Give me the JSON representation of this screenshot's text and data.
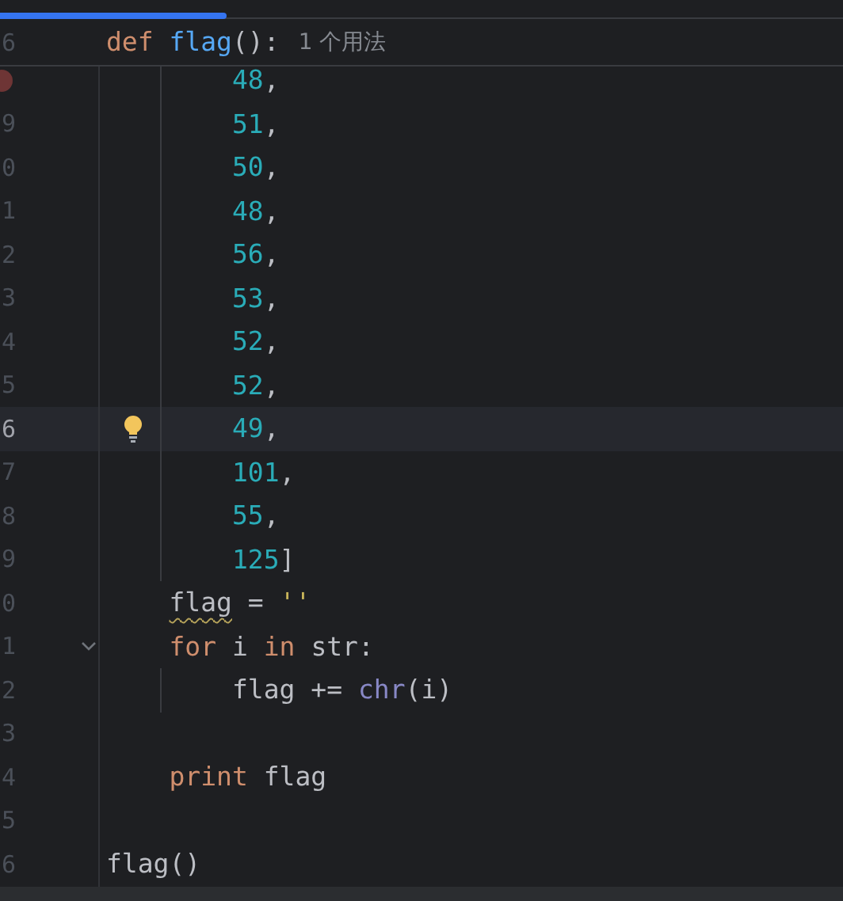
{
  "sticky_header": {
    "line_number": "6",
    "tokens": [
      {
        "kind": "keyword",
        "text": "def "
      },
      {
        "kind": "function",
        "text": "flag"
      },
      {
        "kind": "plain",
        "text": "():"
      }
    ],
    "usage_hint": "1 个用法"
  },
  "lines": [
    {
      "breakpoint": true,
      "current": false,
      "bulb": false,
      "foldable": false,
      "indent_guide": true,
      "tokens": [
        {
          "kind": "number",
          "text": "        48"
        },
        {
          "kind": "plain",
          "text": ","
        }
      ]
    },
    {
      "number": "9",
      "breakpoint": false,
      "current": false,
      "bulb": false,
      "foldable": false,
      "indent_guide": true,
      "tokens": [
        {
          "kind": "number",
          "text": "        51"
        },
        {
          "kind": "plain",
          "text": ","
        }
      ]
    },
    {
      "number": "0",
      "breakpoint": false,
      "current": false,
      "bulb": false,
      "foldable": false,
      "indent_guide": true,
      "tokens": [
        {
          "kind": "number",
          "text": "        50"
        },
        {
          "kind": "plain",
          "text": ","
        }
      ]
    },
    {
      "number": "1",
      "breakpoint": false,
      "current": false,
      "bulb": false,
      "foldable": false,
      "indent_guide": true,
      "tokens": [
        {
          "kind": "number",
          "text": "        48"
        },
        {
          "kind": "plain",
          "text": ","
        }
      ]
    },
    {
      "number": "2",
      "breakpoint": false,
      "current": false,
      "bulb": false,
      "foldable": false,
      "indent_guide": true,
      "tokens": [
        {
          "kind": "number",
          "text": "        56"
        },
        {
          "kind": "plain",
          "text": ","
        }
      ]
    },
    {
      "number": "3",
      "breakpoint": false,
      "current": false,
      "bulb": false,
      "foldable": false,
      "indent_guide": true,
      "tokens": [
        {
          "kind": "number",
          "text": "        53"
        },
        {
          "kind": "plain",
          "text": ","
        }
      ]
    },
    {
      "number": "4",
      "breakpoint": false,
      "current": false,
      "bulb": false,
      "foldable": false,
      "indent_guide": true,
      "tokens": [
        {
          "kind": "number",
          "text": "        52"
        },
        {
          "kind": "plain",
          "text": ","
        }
      ]
    },
    {
      "number": "5",
      "breakpoint": false,
      "current": false,
      "bulb": false,
      "foldable": false,
      "indent_guide": true,
      "tokens": [
        {
          "kind": "number",
          "text": "        52"
        },
        {
          "kind": "plain",
          "text": ","
        }
      ]
    },
    {
      "number": "6",
      "breakpoint": false,
      "current": true,
      "bulb": true,
      "foldable": false,
      "indent_guide": true,
      "tokens": [
        {
          "kind": "number",
          "text": "        49"
        },
        {
          "kind": "plain",
          "text": ","
        }
      ]
    },
    {
      "number": "7",
      "breakpoint": false,
      "current": false,
      "bulb": false,
      "foldable": false,
      "indent_guide": true,
      "tokens": [
        {
          "kind": "number",
          "text": "        101"
        },
        {
          "kind": "plain",
          "text": ","
        }
      ]
    },
    {
      "number": "8",
      "breakpoint": false,
      "current": false,
      "bulb": false,
      "foldable": false,
      "indent_guide": true,
      "tokens": [
        {
          "kind": "number",
          "text": "        55"
        },
        {
          "kind": "plain",
          "text": ","
        }
      ]
    },
    {
      "number": "9",
      "breakpoint": false,
      "current": false,
      "bulb": false,
      "foldable": false,
      "indent_guide": true,
      "tokens": [
        {
          "kind": "number",
          "text": "        125"
        },
        {
          "kind": "plain",
          "text": "]"
        }
      ]
    },
    {
      "number": "0",
      "breakpoint": false,
      "current": false,
      "bulb": false,
      "foldable": false,
      "indent_guide": false,
      "tokens": [
        {
          "kind": "plain",
          "text": "    flag",
          "warning": true
        },
        {
          "kind": "plain",
          "text": " = "
        },
        {
          "kind": "string",
          "text": "''"
        }
      ]
    },
    {
      "number": "1",
      "breakpoint": false,
      "current": false,
      "bulb": false,
      "foldable": true,
      "indent_guide": false,
      "tokens": [
        {
          "kind": "keyword",
          "text": "    for "
        },
        {
          "kind": "plain",
          "text": "i "
        },
        {
          "kind": "keyword",
          "text": "in "
        },
        {
          "kind": "plain",
          "text": "str:"
        }
      ]
    },
    {
      "number": "2",
      "breakpoint": false,
      "current": false,
      "bulb": false,
      "foldable": false,
      "indent_guide": true,
      "tokens": [
        {
          "kind": "plain",
          "text": "        flag += "
        },
        {
          "kind": "builtin",
          "text": "chr"
        },
        {
          "kind": "plain",
          "text": "(i)"
        }
      ]
    },
    {
      "number": "3",
      "breakpoint": false,
      "current": false,
      "bulb": false,
      "foldable": false,
      "indent_guide": false
    },
    {
      "number": "4",
      "breakpoint": false,
      "current": false,
      "bulb": false,
      "foldable": false,
      "indent_guide": false,
      "tokens": [
        {
          "kind": "keyword",
          "text": "    print "
        },
        {
          "kind": "plain",
          "text": "flag"
        }
      ]
    },
    {
      "number": "5",
      "breakpoint": false,
      "current": false,
      "bulb": false,
      "foldable": false,
      "indent_guide": false
    },
    {
      "number": "6",
      "breakpoint": false,
      "current": false,
      "bulb": false,
      "foldable": false,
      "indent_guide": false,
      "tokens": [
        {
          "kind": "plain",
          "text": "flag()"
        }
      ]
    }
  ]
}
